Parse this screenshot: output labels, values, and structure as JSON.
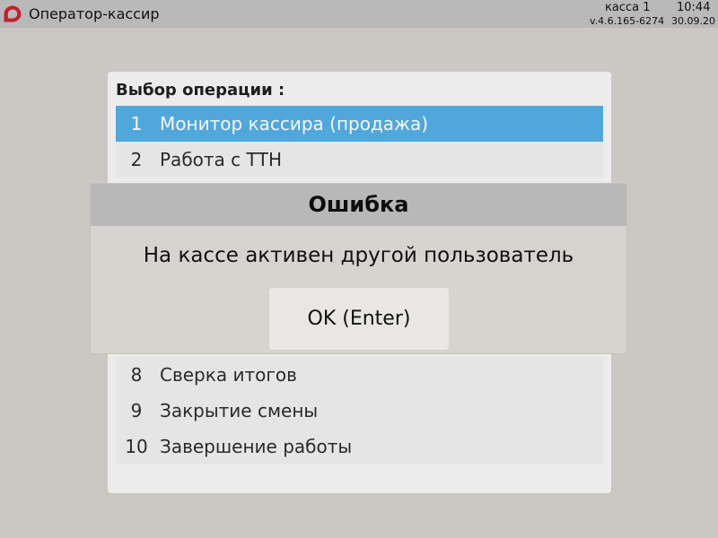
{
  "topbar": {
    "app_title": "Оператор-кассир",
    "kassa": "касса 1",
    "time": "10:44",
    "version": "v.4.6.165-6274",
    "date": "30.09.20",
    "logo_icon": "cashier-logo-icon",
    "logo_color": "#c0222b"
  },
  "menu": {
    "title": "Выбор операции :",
    "items": [
      {
        "num": "1",
        "label": "Монитор кассира (продажа)",
        "selected": true
      },
      {
        "num": "2",
        "label": "Работа с ТТН",
        "selected": false
      },
      {
        "num": "8",
        "label": "Сверка итогов",
        "selected": false
      },
      {
        "num": "9",
        "label": "Закрытие смены",
        "selected": false
      },
      {
        "num": "10",
        "label": "Завершение работы",
        "selected": false
      }
    ],
    "selected_color": "#51a7db"
  },
  "dialog": {
    "title": "Ошибка",
    "message": "На кассе активен другой пользователь",
    "button_label": "OK (Enter)"
  }
}
